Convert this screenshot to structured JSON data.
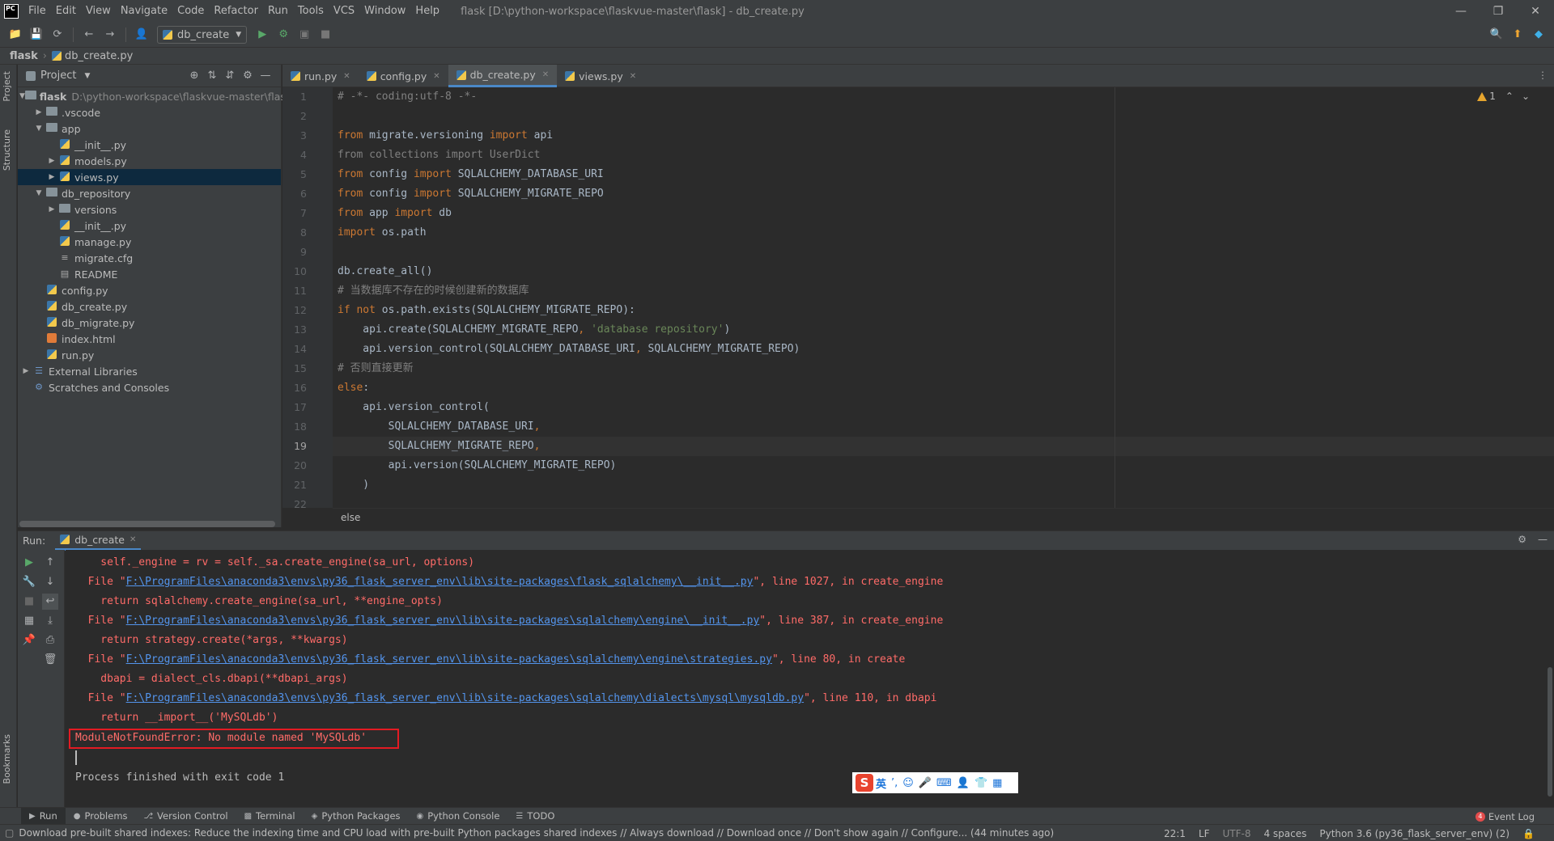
{
  "app": {
    "logo_text": "PC",
    "menu": [
      "File",
      "Edit",
      "View",
      "Navigate",
      "Code",
      "Refactor",
      "Run",
      "Tools",
      "VCS",
      "Window",
      "Help"
    ],
    "window_title": "flask [D:\\python-workspace\\flaskvue-master\\flask] - db_create.py"
  },
  "toolbar": {
    "run_config": "db_create"
  },
  "breadcrumb": {
    "root": "flask",
    "file": "db_create.py"
  },
  "left_strip": {
    "project": "Project",
    "structure": "Structure",
    "bookmarks": "Bookmarks"
  },
  "project_panel": {
    "title": "Project",
    "tree": [
      {
        "label": "flask",
        "path": "D:\\python-workspace\\flaskvue-master\\flas"
      },
      {
        "label": ".vscode"
      },
      {
        "label": "app"
      },
      {
        "label": "__init__.py"
      },
      {
        "label": "models.py"
      },
      {
        "label": "views.py"
      },
      {
        "label": "db_repository"
      },
      {
        "label": "versions"
      },
      {
        "label": "__init__.py"
      },
      {
        "label": "manage.py"
      },
      {
        "label": "migrate.cfg"
      },
      {
        "label": "README"
      },
      {
        "label": "config.py"
      },
      {
        "label": "db_create.py"
      },
      {
        "label": "db_migrate.py"
      },
      {
        "label": "index.html"
      },
      {
        "label": "run.py"
      },
      {
        "label": "External Libraries"
      },
      {
        "label": "Scratches and Consoles"
      }
    ]
  },
  "editor": {
    "tabs": [
      "run.py",
      "config.py",
      "db_create.py",
      "views.py"
    ],
    "active_tab": "db_create.py",
    "warning_count": "1",
    "current_line": 19,
    "breadcrumb_status": "else"
  },
  "run_panel": {
    "label": "Run:",
    "tab": "db_create",
    "lines": [
      "    self._engine = rv = self._sa.create_engine(sa_url, options)",
      "  File \"",
      "F:\\ProgramFiles\\anaconda3\\envs\\py36_flask_server_env\\lib\\site-packages\\flask_sqlalchemy\\__init__.py",
      "\", line 1027, in create_engine",
      "    return sqlalchemy.create_engine(sa_url, **engine_opts)",
      "F:\\ProgramFiles\\anaconda3\\envs\\py36_flask_server_env\\lib\\site-packages\\sqlalchemy\\engine\\__init__.py",
      "\", line 387, in create_engine",
      "    return strategy.create(*args, **kwargs)",
      "F:\\ProgramFiles\\anaconda3\\envs\\py36_flask_server_env\\lib\\site-packages\\sqlalchemy\\engine\\strategies.py",
      "\", line 80, in create",
      "    dbapi = dialect_cls.dbapi(**dbapi_args)",
      "F:\\ProgramFiles\\anaconda3\\envs\\py36_flask_server_env\\lib\\site-packages\\sqlalchemy\\dialects\\mysql\\mysqldb.py",
      "\", line 110, in dbapi",
      "    return __import__('MySQLdb')",
      "ModuleNotFoundError: No module named 'MySQLdb'",
      "Process finished with exit code 1"
    ],
    "ime_label": "英"
  },
  "bottom_tabs": [
    "Run",
    "Problems",
    "Version Control",
    "Terminal",
    "Python Packages",
    "Python Console",
    "TODO"
  ],
  "event_log": {
    "label": "Event Log",
    "count": "4"
  },
  "status_bar": {
    "message": "Download pre-built shared indexes: Reduce the indexing time and CPU load with pre-built Python packages shared indexes // Always download // Download once // Don't show again // Configure... (44 minutes ago)",
    "position": "22:1",
    "line_sep": "LF",
    "encoding": "UTF-8",
    "indent": "4 spaces",
    "interpreter": "Python 3.6 (py36_flask_server_env) (2)"
  },
  "colors": {
    "accent": "#4a88c7",
    "error_text": "#ff6b68",
    "error_box": "#e31b23",
    "keyword": "#cc7832",
    "comment": "#808080",
    "string": "#6a8759"
  }
}
